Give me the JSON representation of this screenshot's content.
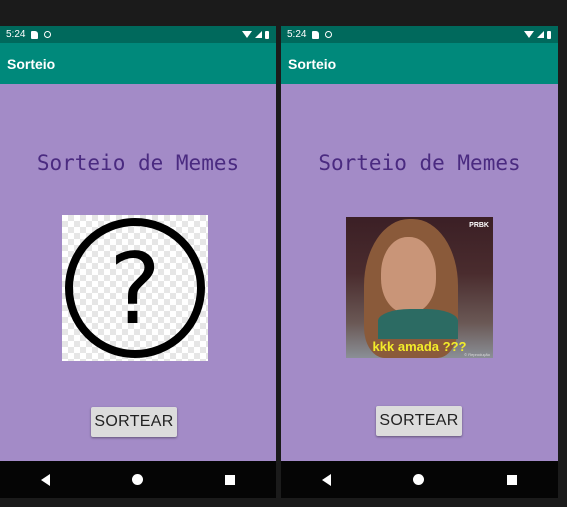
{
  "screens": [
    {
      "status_time": "5:24",
      "app_title": "Sorteio",
      "heading": "Sorteio de Memes",
      "image_kind": "question-mark-placeholder",
      "image_glyph": "?",
      "button_label": "SORTEAR"
    },
    {
      "status_time": "5:24",
      "app_title": "Sorteio",
      "heading": "Sorteio de Memes",
      "image_kind": "meme-photo",
      "meme_caption": "kkk amada ???",
      "meme_logo": "PRBK",
      "meme_credit": "© Reprodução",
      "button_label": "SORTEAR"
    }
  ],
  "colors": {
    "status_bar": "#00695c",
    "app_bar": "#00897b",
    "background": "#a38bc7",
    "heading_text": "#4a2a80",
    "button": "#dcdcdc",
    "nav_bar": "#050505"
  },
  "icons": [
    "sd-card-icon",
    "sync-icon",
    "wifi-icon",
    "signal-icon",
    "battery-icon",
    "nav-back-icon",
    "nav-home-icon",
    "nav-recent-icon"
  ]
}
